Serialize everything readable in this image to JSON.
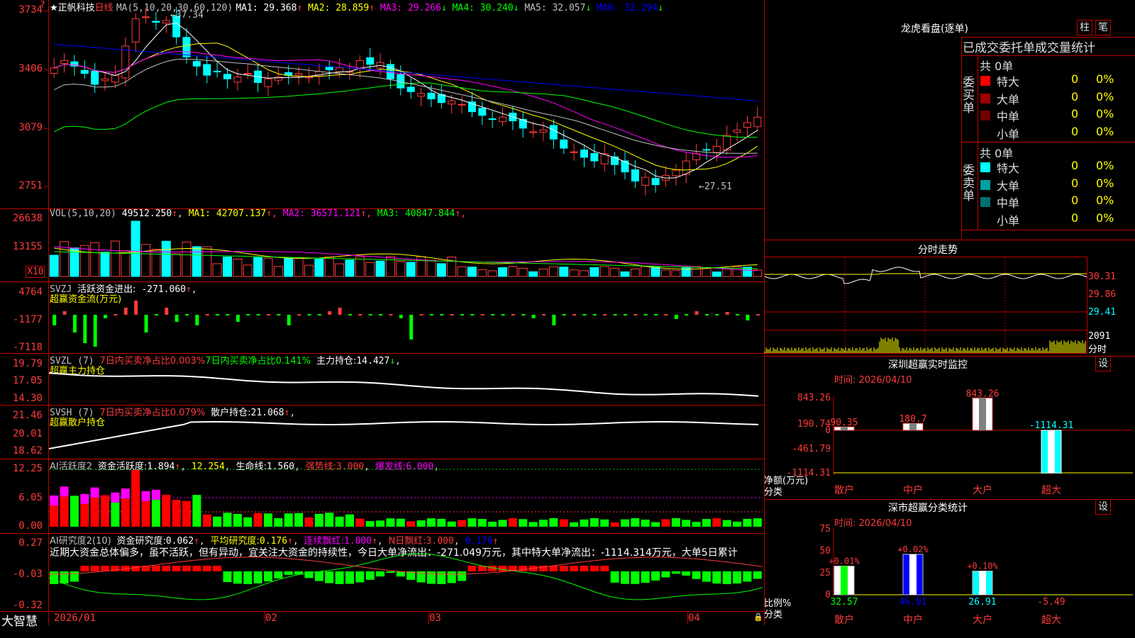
{
  "stock": {
    "name": "正帆科技",
    "period": "日线",
    "ma_header": "MA(5,10,20,30,60,120)",
    "ma": [
      {
        "label": "MA1:",
        "value": "29.368",
        "arrow": "↑",
        "color": "#ffffff"
      },
      {
        "label": "MA2:",
        "value": "28.859",
        "arrow": "↑",
        "color": "#ffff00"
      },
      {
        "label": "MA3:",
        "value": "29.266",
        "arrow": "↓",
        "color": "#ff00ff"
      },
      {
        "label": "MA4:",
        "value": "30.240",
        "arrow": "↓",
        "color": "#00ff00"
      },
      {
        "label": "MA5:",
        "value": "32.057",
        "arrow": "↓",
        "color": "#c0c0c0"
      },
      {
        "label": "MA6:",
        "value": "32.294",
        "arrow": "↓",
        "color": "#0000ff"
      }
    ],
    "high_mark": "37.34",
    "low_mark": "27.51",
    "y_labels": [
      "3734",
      "3406",
      "3079",
      "2751"
    ]
  },
  "volume": {
    "header": "VOL(5,10,20)",
    "value": "49512.250",
    "ma": [
      {
        "label": "MA1:",
        "value": "42707.137",
        "color": "#ffff00"
      },
      {
        "label": "MA2:",
        "value": "36571.121",
        "color": "#ff00ff"
      },
      {
        "label": "MA3:",
        "value": "40847.844",
        "color": "#00ff00"
      }
    ],
    "y_labels": [
      "26638",
      "13155"
    ],
    "unit": "X10"
  },
  "svzj": {
    "header": "SVZJ",
    "title": "活跃资金进出:",
    "value": "-271.060",
    "subtitle": "超赢资金流(万元)",
    "y_labels": [
      "4764",
      "-1177",
      "-7118"
    ]
  },
  "svzl": {
    "header": "SVZL (7)",
    "text1": "7日内买卖净占比0.003%",
    "text2": "7日内买卖净占比0.141%",
    "holding_label": "主力持仓:",
    "holding": "14.427",
    "subtitle": "超赢主力持仓",
    "y_labels": [
      "19.79",
      "17.05",
      "14.30"
    ]
  },
  "svsh": {
    "header": "SVSH (7)",
    "text1": "7日内买卖净占比0.079%",
    "holding_label": "散户持仓:",
    "holding": "21.068",
    "subtitle": "超赢散户持仓",
    "y_labels": [
      "21.46",
      "20.01",
      "18.62"
    ]
  },
  "ai_active": {
    "header": "AI活跃度2",
    "l1": "资金活跃度:",
    "v1": "1.894",
    "v2": "12.254",
    "l3": "生命线:",
    "v3": "1.560",
    "l4": "强势线:",
    "v4": "3.000",
    "l5": "爆发线:",
    "v5": "6.000",
    "y_labels": [
      "12.25",
      "6.05",
      "0.00"
    ]
  },
  "ai_research": {
    "header": "AI研究度2(10)",
    "l1": "资金研究度:",
    "v1": "0.062",
    "l2": "平均研究度:",
    "v2": "0.176",
    "l3": "连续飘红:",
    "v3": "1.000",
    "l4": "N日飘红:",
    "v4": "3.000",
    "v5": "0.176",
    "commentary": "近期大资金总体偏多，虽不活跃，但有异动，宜关注大资金的持续性，今日大单净流出：-271.049万元，其中特大单净流出：-1114.314万元，大单5日累计",
    "y_labels": [
      "0.27",
      "-0.03",
      "-0.32"
    ]
  },
  "x_axis": [
    "2026/01",
    "02",
    "03",
    "04"
  ],
  "brand": "大智慧",
  "right": {
    "title": "龙虎看盘(逐单)",
    "btn_bar": "柱",
    "btn_pen": "笔",
    "tabs": [
      "已成交",
      "委托单",
      "成交量统计"
    ],
    "buy_label": "委买单",
    "sell_label": "委卖单",
    "buy_total": "共 0单",
    "sell_total": "共 0单",
    "buy_rows": [
      {
        "label": "特大",
        "count": "0",
        "pct": "0%",
        "color": "#ff0000"
      },
      {
        "label": "大单",
        "count": "0",
        "pct": "0%",
        "color": "#a00000"
      },
      {
        "label": "中单",
        "count": "0",
        "pct": "0%",
        "color": "#700000"
      },
      {
        "label": "小单",
        "count": "0",
        "pct": "0%",
        "color": "#000000"
      }
    ],
    "sell_rows": [
      {
        "label": "特大",
        "count": "0",
        "pct": "0%",
        "color": "#00ffff"
      },
      {
        "label": "大单",
        "count": "0",
        "pct": "0%",
        "color": "#00a0a0"
      },
      {
        "label": "中单",
        "count": "0",
        "pct": "0%",
        "color": "#007070"
      },
      {
        "label": "小单",
        "count": "0",
        "pct": "0%",
        "color": "#000000"
      }
    ],
    "intraday_title": "分时走势",
    "intraday_labels": [
      "30.31",
      "29.86",
      "29.41",
      "2091",
      "分时"
    ],
    "sz_monitor": {
      "title": "深圳超赢实时监控",
      "btn": "设",
      "time": "时间: 2026/04/10",
      "y_labels": [
        "843.26",
        "190.74",
        "0",
        "-461.79",
        "-1114.31"
      ],
      "axis_title": "净额(万元)",
      "axis_cat": "分类",
      "categories": [
        "散户",
        "中户",
        "大户",
        "超大"
      ],
      "values": [
        90.35,
        180.7,
        843.26,
        -1114.31
      ],
      "value_labels": [
        "90.35",
        "180.7",
        "843.26",
        "-1114.31"
      ]
    },
    "sz_stats": {
      "title": "深市超赢分类统计",
      "btn": "设",
      "time": "时间: 2026/04/10",
      "y_labels": [
        "75",
        "50",
        "25",
        "0"
      ],
      "axis_title": "比例%",
      "axis_cat": "分类",
      "categories": [
        "散户",
        "中户",
        "大户",
        "超大"
      ],
      "values": [
        32.57,
        46.01,
        26.91,
        -5.49
      ],
      "value_labels": [
        "32.57",
        "46.01",
        "26.91",
        "-5.49"
      ],
      "deltas": [
        "+0.01%",
        "+0.02%",
        "+0.10%",
        ""
      ]
    }
  }
}
